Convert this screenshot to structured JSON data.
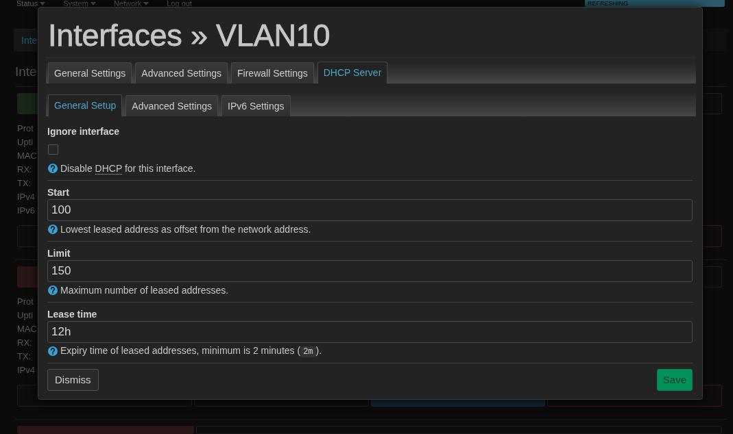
{
  "background_page": {
    "nav": [
      {
        "label": "Status",
        "dropdown": true
      },
      {
        "label": "System",
        "dropdown": true
      },
      {
        "label": "Network",
        "dropdown": true
      },
      {
        "label": "Log out",
        "dropdown": false
      }
    ],
    "refresh_badge": "REFRESHING",
    "tabs": [
      {
        "label": "Inte",
        "selected": true
      }
    ],
    "heading": "Inte",
    "interfaces": [
      {
        "color": "#182818",
        "lines": [
          "Prot",
          "Upti",
          "MAC",
          "RX:",
          "TX:",
          "IPv4",
          "IPv6"
        ]
      },
      {
        "color": "#2a1616",
        "lines": [
          "Prot",
          "Upti",
          "MAC",
          "RX:",
          "TX:",
          "IPv4"
        ]
      },
      {
        "color": "#2a1616"
      }
    ]
  },
  "dialog": {
    "title": "Interfaces » VLAN10",
    "tabs": [
      {
        "label": "General Settings",
        "selected": false
      },
      {
        "label": "Advanced Settings",
        "selected": false
      },
      {
        "label": "Firewall Settings",
        "selected": false
      },
      {
        "label": "DHCP Server",
        "selected": true
      }
    ],
    "subtabs": [
      {
        "label": "General Setup",
        "selected": true
      },
      {
        "label": "Advanced Settings",
        "selected": false
      },
      {
        "label": "IPv6 Settings",
        "selected": false
      }
    ],
    "fields": [
      {
        "kind": "checkbox",
        "label": "Ignore interface",
        "checked": false,
        "description": [
          {
            "kind": "plain",
            "text": "Disable "
          },
          {
            "kind": "abbr",
            "text": "DHCP"
          },
          {
            "kind": "plain",
            "text": " for this interface."
          }
        ]
      },
      {
        "kind": "text",
        "label": "Start",
        "value": "100",
        "description": [
          {
            "kind": "plain",
            "text": "Lowest leased address as offset from the network address."
          }
        ]
      },
      {
        "kind": "text",
        "label": "Limit",
        "value": "150",
        "description": [
          {
            "kind": "plain",
            "text": "Maximum number of leased addresses."
          }
        ]
      },
      {
        "kind": "text",
        "label": "Lease time",
        "value": "12h",
        "description": [
          {
            "kind": "plain",
            "text": "Expiry time of leased addresses, minimum is 2 minutes ("
          },
          {
            "kind": "code",
            "text": "2m"
          },
          {
            "kind": "plain",
            "text": ")."
          }
        ]
      }
    ],
    "buttons": [
      {
        "kind": "dismiss",
        "label": "Dismiss"
      },
      {
        "kind": "save",
        "label": "Save"
      }
    ]
  }
}
